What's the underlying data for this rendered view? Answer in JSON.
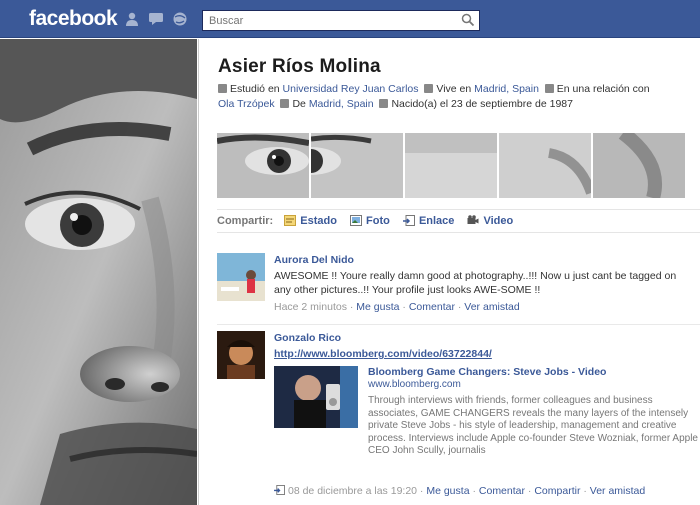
{
  "header": {
    "logo": "facebook",
    "search_placeholder": "Buscar"
  },
  "profile": {
    "name": "Asier Ríos Molina",
    "info": {
      "studied_prefix": "Estudió en",
      "university": "Universidad Rey Juan Carlos",
      "lives_prefix": "Vive en",
      "city": "Madrid, Spain",
      "relationship_prefix": "En una relación con",
      "partner": "Ola Trzópek",
      "from_prefix": "De",
      "hometown": "Madrid, Spain",
      "birthday": "Nacido(a) el 23 de septiembre de 1987"
    }
  },
  "share": {
    "label": "Compartir:",
    "items": [
      {
        "label": "Estado",
        "icon": "status-icon"
      },
      {
        "label": "Foto",
        "icon": "photo-icon"
      },
      {
        "label": "Enlace",
        "icon": "link-icon"
      },
      {
        "label": "Video",
        "icon": "video-icon"
      }
    ]
  },
  "posts": [
    {
      "author": "Aurora Del Nido",
      "text": "AWESOME !! Youre really damn good at photography..!!! Now u just cant be tagged on any other pictures..!! Your profile just looks AWE-SOME !!",
      "time": "Hace 2 minutos",
      "sep": "·",
      "actions": [
        "Me gusta",
        "Comentar",
        "Ver amistad"
      ]
    },
    {
      "author": "Gonzalo Rico",
      "url": "http://www.bloomberg.com/video/63722844/",
      "attachment": {
        "title": "Bloomberg Game Changers: Steve Jobs - Video",
        "site": "www.bloomberg.com",
        "description": "Through interviews with friends, former colleagues and business associates, GAME CHANGERS reveals the many layers of the intensely private Steve Jobs - his style of leadership, management and creative process. Interviews include Apple co-founder Steve Wozniak, former Apple CEO John Scully, journalis"
      },
      "time": "08 de diciembre a las 19:20",
      "sep": "·",
      "actions": [
        "Me gusta",
        "Comentar",
        "Compartir",
        "Ver amistad"
      ]
    }
  ],
  "colors": {
    "brand": "#3b5998",
    "link": "#3b5998"
  }
}
